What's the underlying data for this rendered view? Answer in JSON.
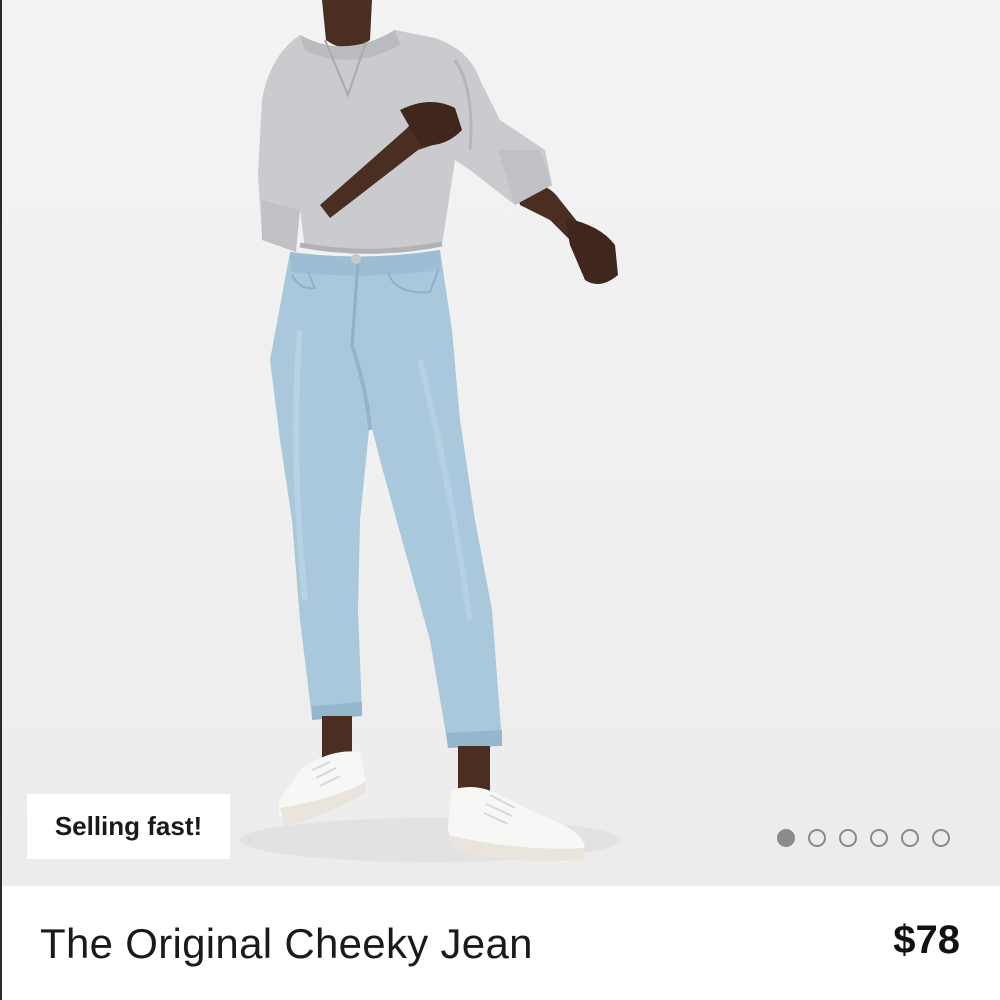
{
  "product": {
    "badge": "Selling fast!",
    "name": "The Original Cheeky Jean",
    "price": "$78"
  },
  "image": {
    "subject": "product-photo-model-wearing-jeans",
    "carousel": {
      "total": 6,
      "active_index": 0
    }
  },
  "colors": {
    "background": "#f1f1f1",
    "denim": "#a9c8dc",
    "sweater": "#c9cbce",
    "sneaker": "#f7f7f5",
    "skin": "#4a2e22",
    "dot": "#8a8a8a"
  }
}
